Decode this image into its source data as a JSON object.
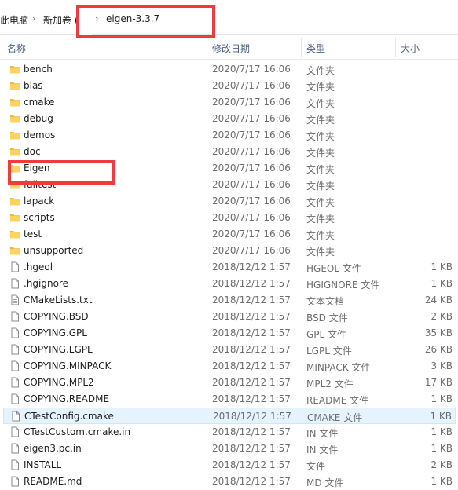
{
  "breadcrumb": {
    "items": [
      "此电脑",
      "新加卷 (F:)",
      "eigen-3.3.7"
    ]
  },
  "columns": {
    "name": "名称",
    "date": "修改日期",
    "type": "类型",
    "size": "大小"
  },
  "colors": {
    "folder": "#ffd35c",
    "folder_dark": "#e8b84a",
    "highlight_box": "#ef3b3b",
    "selected_row": "#e5f3ff"
  },
  "files": [
    {
      "name": "bench",
      "date": "2020/7/17 16:06",
      "type": "文件夹",
      "size": "",
      "icon": "folder-icon"
    },
    {
      "name": "blas",
      "date": "2020/7/17 16:06",
      "type": "文件夹",
      "size": "",
      "icon": "folder-icon"
    },
    {
      "name": "cmake",
      "date": "2020/7/17 16:06",
      "type": "文件夹",
      "size": "",
      "icon": "folder-icon"
    },
    {
      "name": "debug",
      "date": "2020/7/17 16:06",
      "type": "文件夹",
      "size": "",
      "icon": "folder-icon"
    },
    {
      "name": "demos",
      "date": "2020/7/17 16:06",
      "type": "文件夹",
      "size": "",
      "icon": "folder-icon"
    },
    {
      "name": "doc",
      "date": "2020/7/17 16:06",
      "type": "文件夹",
      "size": "",
      "icon": "folder-icon"
    },
    {
      "name": "Eigen",
      "date": "2020/7/17 16:06",
      "type": "文件夹",
      "size": "",
      "icon": "folder-icon"
    },
    {
      "name": "failtest",
      "date": "2020/7/17 16:06",
      "type": "文件夹",
      "size": "",
      "icon": "folder-icon"
    },
    {
      "name": "lapack",
      "date": "2020/7/17 16:06",
      "type": "文件夹",
      "size": "",
      "icon": "folder-icon"
    },
    {
      "name": "scripts",
      "date": "2020/7/17 16:06",
      "type": "文件夹",
      "size": "",
      "icon": "folder-icon"
    },
    {
      "name": "test",
      "date": "2020/7/17 16:06",
      "type": "文件夹",
      "size": "",
      "icon": "folder-icon"
    },
    {
      "name": "unsupported",
      "date": "2020/7/17 16:06",
      "type": "文件夹",
      "size": "",
      "icon": "folder-icon"
    },
    {
      "name": ".hgeol",
      "date": "2018/12/12 1:57",
      "type": "HGEOL 文件",
      "size": "1 KB",
      "icon": "file-icon"
    },
    {
      "name": ".hgignore",
      "date": "2018/12/12 1:57",
      "type": "HGIGNORE 文件",
      "size": "1 KB",
      "icon": "file-icon"
    },
    {
      "name": "CMakeLists.txt",
      "date": "2018/12/12 1:57",
      "type": "文本文档",
      "size": "24 KB",
      "icon": "text-file-icon"
    },
    {
      "name": "COPYING.BSD",
      "date": "2018/12/12 1:57",
      "type": "BSD 文件",
      "size": "2 KB",
      "icon": "file-icon"
    },
    {
      "name": "COPYING.GPL",
      "date": "2018/12/12 1:57",
      "type": "GPL 文件",
      "size": "35 KB",
      "icon": "file-icon"
    },
    {
      "name": "COPYING.LGPL",
      "date": "2018/12/12 1:57",
      "type": "LGPL 文件",
      "size": "26 KB",
      "icon": "file-icon"
    },
    {
      "name": "COPYING.MINPACK",
      "date": "2018/12/12 1:57",
      "type": "MINPACK 文件",
      "size": "3 KB",
      "icon": "file-icon"
    },
    {
      "name": "COPYING.MPL2",
      "date": "2018/12/12 1:57",
      "type": "MPL2 文件",
      "size": "17 KB",
      "icon": "file-icon"
    },
    {
      "name": "COPYING.README",
      "date": "2018/12/12 1:57",
      "type": "README 文件",
      "size": "1 KB",
      "icon": "file-icon"
    },
    {
      "name": "CTestConfig.cmake",
      "date": "2018/12/12 1:57",
      "type": "CMAKE 文件",
      "size": "1 KB",
      "icon": "file-icon",
      "selected": true
    },
    {
      "name": "CTestCustom.cmake.in",
      "date": "2018/12/12 1:57",
      "type": "IN 文件",
      "size": "1 KB",
      "icon": "file-icon"
    },
    {
      "name": "eigen3.pc.in",
      "date": "2018/12/12 1:57",
      "type": "IN 文件",
      "size": "1 KB",
      "icon": "file-icon"
    },
    {
      "name": "INSTALL",
      "date": "2018/12/12 1:57",
      "type": "文件",
      "size": "2 KB",
      "icon": "file-icon"
    },
    {
      "name": "README.md",
      "date": "2018/12/12 1:57",
      "type": "MD 文件",
      "size": "1 KB",
      "icon": "file-icon"
    }
  ]
}
